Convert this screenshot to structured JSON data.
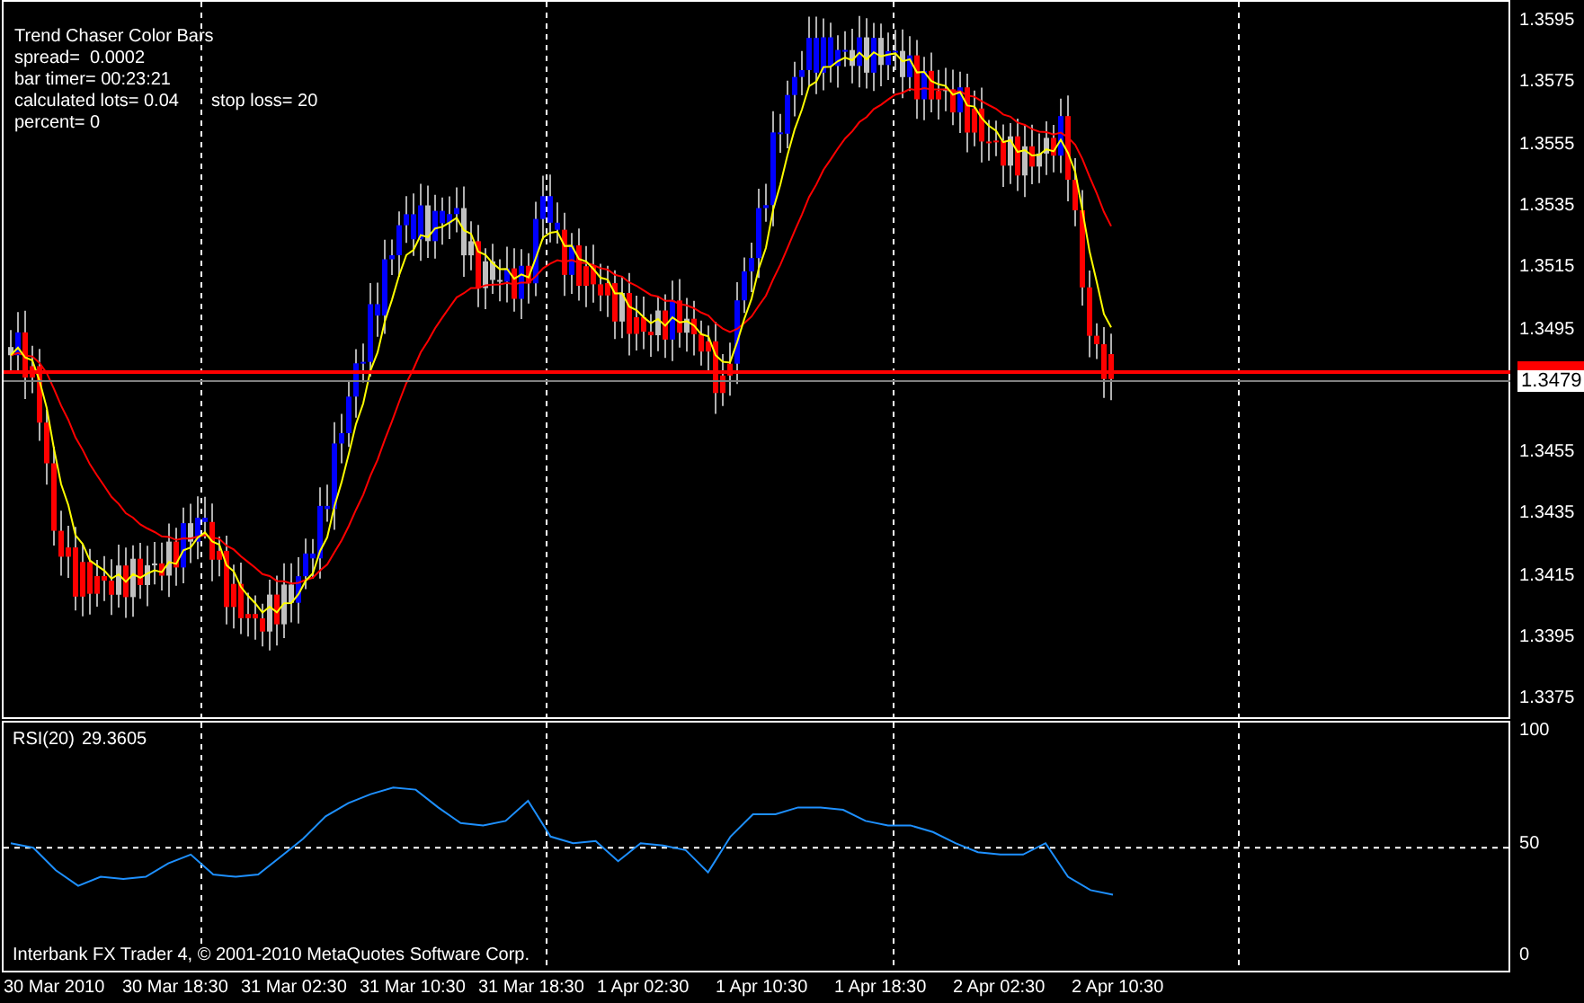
{
  "info": [
    {
      "text": "Trend Chaser Color Bars"
    },
    {
      "text": "spread=  0.0002"
    },
    {
      "text": "bar timer= 00:23:21"
    },
    {
      "text": "calculated lots= 0.04",
      "extra": "stop loss= 20"
    },
    {
      "text": "percent= 0"
    }
  ],
  "price_axis": {
    "ticks": [
      "1.3595",
      "1.3575",
      "1.3555",
      "1.3535",
      "1.3515",
      "1.3495",
      "1.3455",
      "1.3435",
      "1.3415",
      "1.3395",
      "1.3375"
    ],
    "bid_label": "1.3479"
  },
  "rsi_panel": {
    "reading": "29.3605",
    "copyright": "Interbank FX Trader 4, © 2001-2010 MetaQuotes Software Corp.",
    "chart_data": {
      "type": "line",
      "ylim": [
        -5,
        106
      ],
      "yticks": [
        0,
        50,
        100
      ],
      "series": [
        {
          "name": "RSI(20)",
          "color": "#1e90ff",
          "values": [
            52,
            50,
            40,
            33,
            37,
            36,
            37,
            43,
            47,
            38,
            37,
            38,
            46,
            54,
            64,
            70,
            74,
            77,
            76,
            68,
            61,
            60,
            62,
            71,
            55,
            52,
            53,
            44,
            52,
            51,
            49,
            39,
            55,
            65,
            65,
            68,
            68,
            67,
            62,
            60,
            60,
            57,
            52,
            48,
            47,
            47,
            52,
            37,
            31,
            29
          ]
        }
      ]
    }
  },
  "time_axis": {
    "labels": [
      "30 Mar 2010",
      "30 Mar 18:30",
      "31 Mar 02:30",
      "31 Mar 10:30",
      "31 Mar 18:30",
      "1 Apr 02:30",
      "1 Apr 10:30",
      "1 Apr 18:30",
      "2 Apr 02:30",
      "2 Apr 10:30"
    ]
  }
}
